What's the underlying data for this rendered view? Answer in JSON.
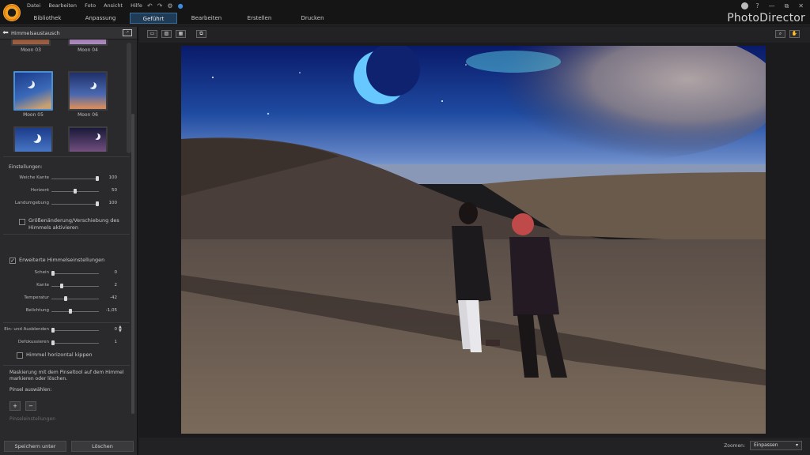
{
  "menu": [
    "Datei",
    "Bearbeiten",
    "Foto",
    "Ansicht",
    "Hilfe"
  ],
  "tabs": [
    {
      "label": "Bibliothek",
      "active": false
    },
    {
      "label": "Anpassung",
      "active": false
    },
    {
      "label": "Geführt",
      "active": true
    },
    {
      "label": "Bearbeiten",
      "active": false
    },
    {
      "label": "Erstellen",
      "active": false
    },
    {
      "label": "Drucken",
      "active": false
    }
  ],
  "brand": "PhotoDirector",
  "window_controls": [
    "?",
    "—",
    "⧉",
    "✕"
  ],
  "panel": {
    "title": "Himmelsaustausch",
    "presets": [
      "Moon 03",
      "Moon 04",
      "Moon 05",
      "Moon 06",
      "",
      ""
    ],
    "selected_preset": "Moon 05",
    "settings_label": "Einstellungen:",
    "sliders1": [
      {
        "label": "Weiche Kante",
        "value": "100",
        "level": 1.0
      },
      {
        "label": "Horizont",
        "value": "50",
        "level": 0.5
      },
      {
        "label": "Landumgebung",
        "value": "100",
        "level": 1.0
      }
    ],
    "resize_checkbox": "Größenänderung/Verschiebung des Himmels aktivieren",
    "advanced_checkbox": "Erweiterte Himmelseinstellungen",
    "sliders2": [
      {
        "label": "Schein",
        "value": "0",
        "level": 0.0
      },
      {
        "label": "Kante",
        "value": "2",
        "level": 0.2
      },
      {
        "label": "Temperatur",
        "value": "-42",
        "level": 0.29
      },
      {
        "label": "Belichtung",
        "value": "-1,05",
        "level": 0.4
      }
    ],
    "fade_slider": {
      "label": "Ein- und Ausblenden",
      "value": "0",
      "level": 0.0
    },
    "defocus_slider": {
      "label": "Defokussieren",
      "value": "1",
      "level": 0.0
    },
    "flip_checkbox": "Himmel horizontal kippen",
    "mask_hint": "Maskierung mit dem Pinseltool auf dem Himmel markieren oder löschen.",
    "brush_label": "Pinsel auswählen:",
    "brush_settings": "Pinseleinstellungen",
    "save_button": "Speichern unter",
    "delete_button": "Löschen"
  },
  "zoom": {
    "label": "Zoomen:",
    "value": "Einpassen"
  }
}
